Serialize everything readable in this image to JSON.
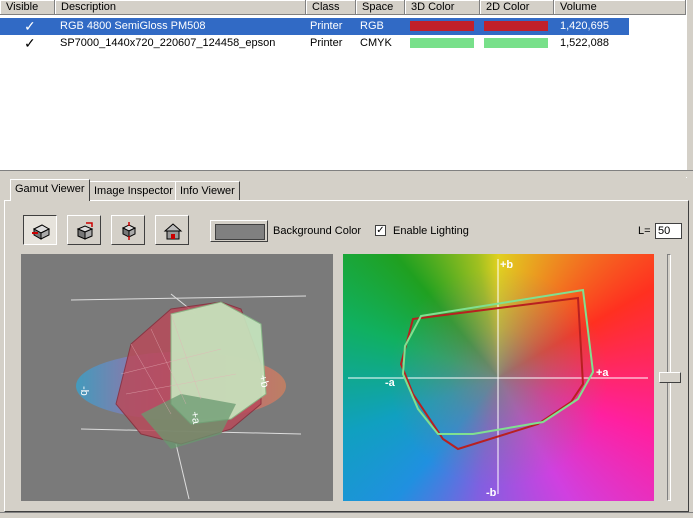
{
  "table": {
    "columns": [
      "Visible",
      "Description",
      "Class",
      "Space",
      "3D Color",
      "2D Color",
      "Volume"
    ],
    "rows": [
      {
        "visible": "✓",
        "description": "RGB 4800 SemiGloss PM508",
        "class": "Printer",
        "space": "RGB",
        "color3d": "#c0202a",
        "color2d": "#c0202a",
        "volume": "1,420,695",
        "selected": true
      },
      {
        "visible": "✓",
        "description": "SP7000_1440x720_220607_124458_epson",
        "class": "Printer",
        "space": "CMYK",
        "color3d": "#78e08a",
        "color2d": "#78e08a",
        "volume": "1,522,088",
        "selected": false
      }
    ]
  },
  "tabs": [
    {
      "label": "Gamut Viewer",
      "active": true
    },
    {
      "label": "Image Inspector",
      "active": false
    },
    {
      "label": "Info Viewer",
      "active": false
    }
  ],
  "toolbar": {
    "buttons": [
      "view-3d-icon",
      "rotate-icon",
      "flip-icon",
      "home-icon"
    ],
    "background_color_label": "Background Color",
    "background_color": "#808080",
    "enable_lighting_label": "Enable Lighting",
    "enable_lighting_checked": "✓",
    "l_label": "L=",
    "l_value": "50"
  },
  "plot2d": {
    "axis_top": "+b",
    "axis_bottom": "-b",
    "axis_left": "-a",
    "axis_right": "+a"
  },
  "plot3d": {
    "axis_label": "+a"
  },
  "colors": {
    "selection": "#316ac5",
    "gamut_red": "#c0202a",
    "gamut_green": "#78e08a"
  }
}
